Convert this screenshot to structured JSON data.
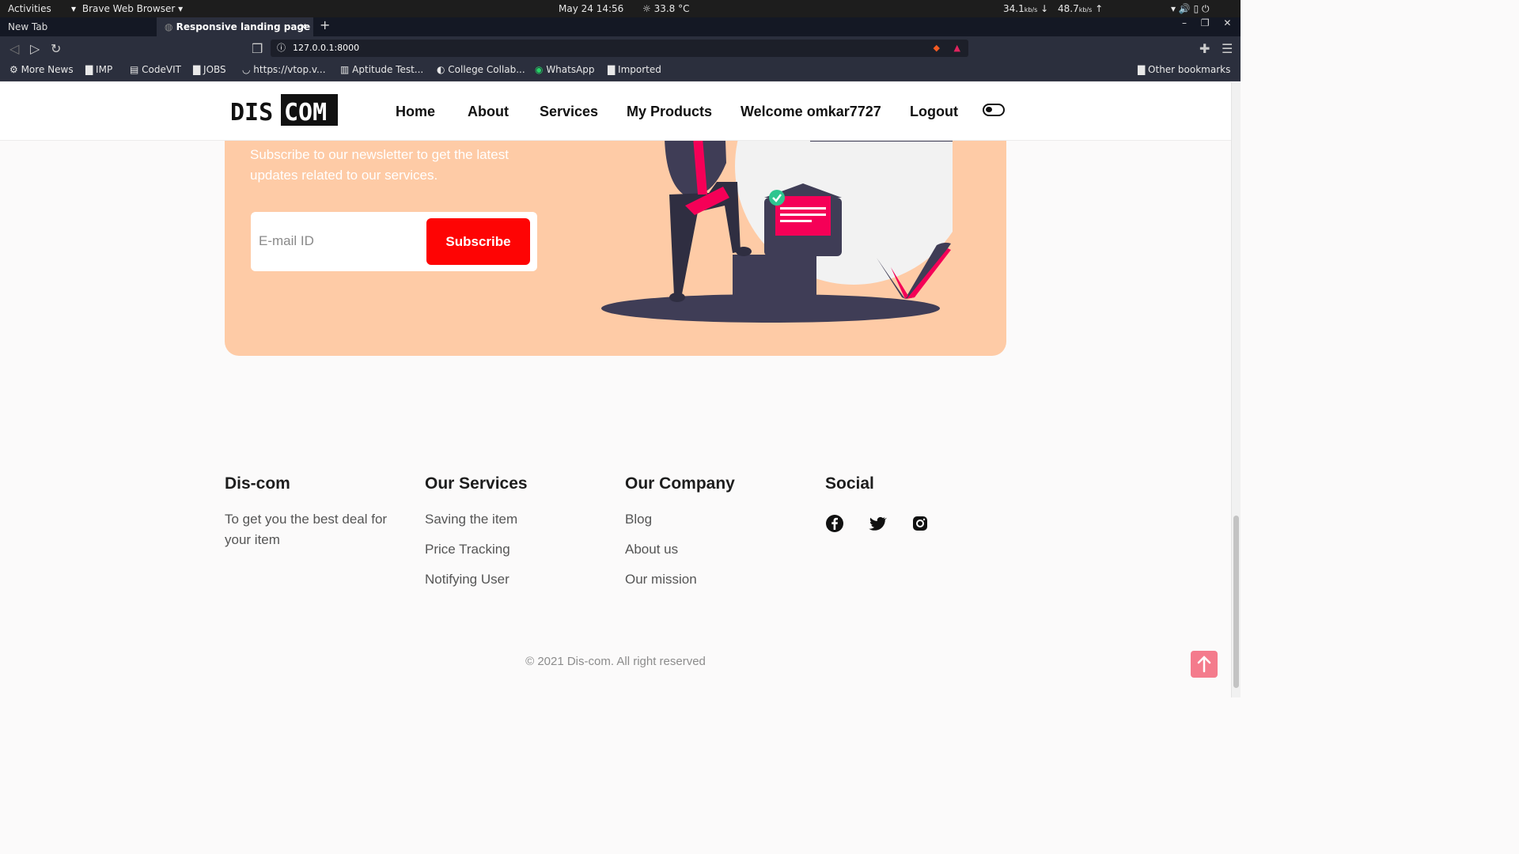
{
  "system": {
    "activities": "Activities",
    "app_name": "Brave Web Browser",
    "datetime": "May 24  14:56",
    "weather": "33.8 °C",
    "net_down": "34.1",
    "net_up": "48.7",
    "net_unit": "kb/s"
  },
  "browser": {
    "tabs": [
      {
        "label": "New Tab"
      },
      {
        "label": "Responsive landing page"
      }
    ],
    "url": "127.0.0.1:8000",
    "bookmarks": [
      "More News",
      "IMP",
      "CodeVIT",
      "JOBS",
      "https://vtop.v...",
      "Aptitude Test...",
      "College Collab...",
      "WhatsApp",
      "Imported"
    ],
    "other_bookmarks": "Other bookmarks"
  },
  "nav": {
    "logo_left": "DIS",
    "logo_right": "COM",
    "links": [
      "Home",
      "About",
      "Services",
      "My Products",
      "Welcome omkar7727",
      "Logout"
    ]
  },
  "newsletter": {
    "text": "Subscribe to our newsletter to get the latest updates related to our services.",
    "email_placeholder": "E-mail ID",
    "button": "Subscribe"
  },
  "footer": {
    "col1": {
      "title": "Dis-com",
      "text": "To get you the best deal for your item"
    },
    "col2": {
      "title": "Our Services",
      "items": [
        "Saving the item",
        "Price Tracking",
        "Notifying User"
      ]
    },
    "col3": {
      "title": "Our Company",
      "items": [
        "Blog",
        "About us",
        "Our mission"
      ]
    },
    "col4": {
      "title": "Social",
      "icons": [
        "facebook-icon",
        "twitter-icon",
        "instagram-icon"
      ]
    },
    "copyright": "© 2021 Dis-com. All right reserved"
  },
  "colors": {
    "accent": "#fe0404",
    "newsletter_bg": "#fecba6",
    "to_top": "#f47b8c"
  }
}
